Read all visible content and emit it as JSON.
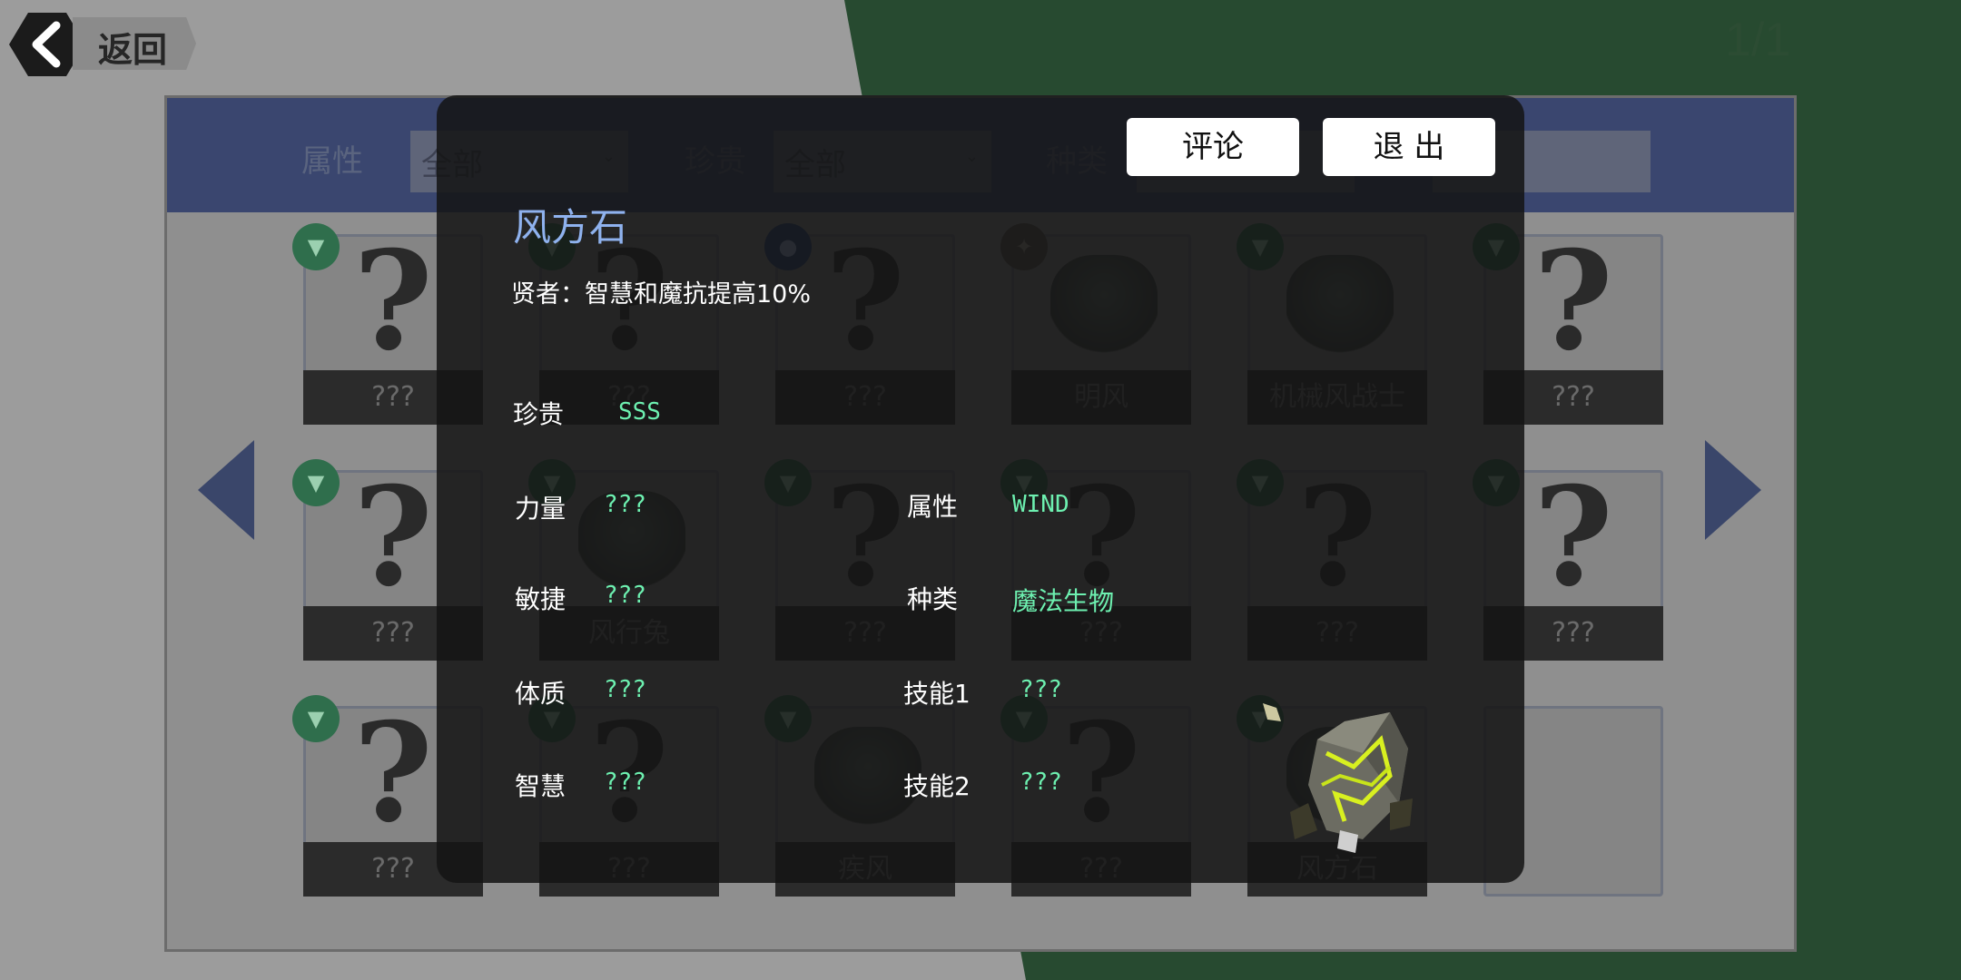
{
  "header": {
    "back_label": "返回",
    "page_indicator": "1/1"
  },
  "filters": {
    "attribute_label": "属性",
    "attribute_value": "全部",
    "rarity_label": "珍贵",
    "rarity_value": "全部",
    "species_label": "种类"
  },
  "cards": [
    {
      "name": "???",
      "badge": "wind",
      "unknown": true
    },
    {
      "name": "???",
      "badge": "wind",
      "unknown": true
    },
    {
      "name": "???",
      "badge": "water",
      "unknown": true
    },
    {
      "name": "明风",
      "badge": "light",
      "unknown": false
    },
    {
      "name": "机械风战士",
      "badge": "wind",
      "unknown": false
    },
    {
      "name": "???",
      "badge": "wind",
      "unknown": true
    },
    {
      "name": "???",
      "badge": "wind",
      "unknown": true
    },
    {
      "name": "风行兔",
      "badge": "wind",
      "unknown": false
    },
    {
      "name": "???",
      "badge": "wind",
      "unknown": true
    },
    {
      "name": "???",
      "badge": "wind",
      "unknown": true
    },
    {
      "name": "???",
      "badge": "wind",
      "unknown": true
    },
    {
      "name": "???",
      "badge": "wind",
      "unknown": true
    },
    {
      "name": "???",
      "badge": "wind",
      "unknown": true
    },
    {
      "name": "???",
      "badge": "wind",
      "unknown": true
    },
    {
      "name": "疾风",
      "badge": "wind",
      "unknown": false
    },
    {
      "name": "???",
      "badge": "wind",
      "unknown": true
    },
    {
      "name": "风方石",
      "badge": "wind",
      "unknown": false
    },
    {
      "name": "",
      "badge": "",
      "unknown": false
    }
  ],
  "modal": {
    "comment_label": "评论",
    "exit_label": "退 出",
    "title": "风方石",
    "description": "贤者：智慧和魔抗提高10%",
    "rarity_label": "珍贵",
    "rarity_value": "SSS",
    "strength_label": "力量",
    "strength_value": "???",
    "agility_label": "敏捷",
    "agility_value": "???",
    "constitution_label": "体质",
    "constitution_value": "???",
    "wisdom_label": "智慧",
    "wisdom_value": "???",
    "attribute_label": "属性",
    "attribute_value": "WIND",
    "species_label": "种类",
    "species_value": "魔法生物",
    "skill1_label": "技能1",
    "skill1_value": "???",
    "skill2_label": "技能2",
    "skill2_value": "???"
  },
  "colors": {
    "accent_green": "#6df0b0",
    "title_blue": "#8fb2ee",
    "filter_bar": "#3a466f"
  },
  "icons": {
    "wind": "wind-element-icon",
    "water": "water-element-icon",
    "light": "light-element-icon"
  }
}
